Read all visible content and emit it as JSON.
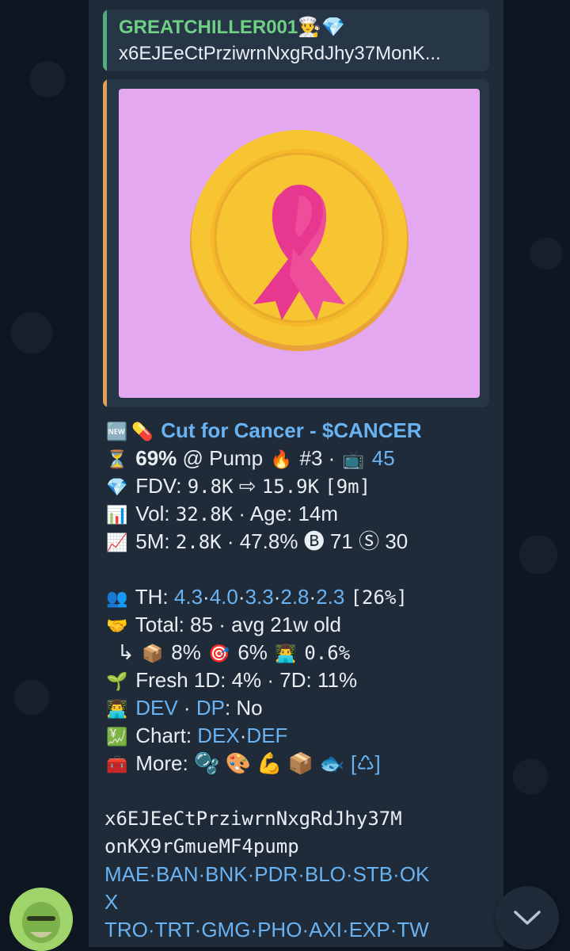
{
  "reply": {
    "author": "GREATCHILLER001👨‍🍳💎",
    "text": "x6EJEeCtPrziwrnNxgRdJhy37MonK..."
  },
  "token": {
    "badge_new": "🆕",
    "pill": "💊",
    "title": "Cut for Cancer - $CANCER"
  },
  "stats": {
    "progress_icon": "⏳",
    "progress_pct": "69%",
    "progress_text": "@ Pump",
    "fire": "🔥",
    "rank": "#3",
    "tv_icon": "📺",
    "tv_count": "45",
    "fdv_icon": "💎",
    "fdv_label": "FDV:",
    "fdv_from": "9.8K",
    "arrow": "⇨",
    "fdv_to": "15.9K",
    "fdv_time": "[9m]",
    "vol_icon": "📊",
    "vol_label": "Vol:",
    "vol_value": "32.8K",
    "age_label": "· Age: 14m",
    "m5_icon": "📈",
    "m5_label": "5M:",
    "m5_value": "2.8K",
    "m5_pct": "· 47.8%",
    "buy_icon": "🅑",
    "buys": "71",
    "sell_icon": "Ⓢ",
    "sells": "30"
  },
  "holders": {
    "th_icon": "👥",
    "th_label": "TH:",
    "th_values": [
      "4.3",
      "4.0",
      "3.3",
      "2.8",
      "2.3"
    ],
    "th_pct": "[26%]",
    "total_icon": "🤝",
    "total_text": "Total: 85 · avg 21w old",
    "sub_arrow": "↳",
    "box_icon": "📦",
    "box_pct": "8%",
    "target_icon": "🎯",
    "target_pct": "6%",
    "dev_icon": "👨‍💻",
    "dev_pct": "0.6%",
    "fresh_icon": "🌱",
    "fresh_text": "Fresh 1D: 4% · 7D: 11%",
    "dev_line_icon": "👨‍💻",
    "dev_link": "DEV",
    "dp_link": "DP",
    "dp_text": ": No",
    "chart_icon": "💹",
    "chart_label": "Chart:",
    "chart_links": [
      "DEX",
      "DEF"
    ],
    "more_icon": "🧰",
    "more_label": "More:",
    "more_icons": "🫧 🎨 💪 📦 🐟",
    "more_recycle": "[♺]"
  },
  "contract": {
    "address_line1": "x6EJEeCtPrziwrnNxgRdJhy37M",
    "address_line2": "onKX9rGmueMF4pump",
    "links_row1": [
      "MAE",
      "BAN",
      "BNK",
      "PDR",
      "BLO",
      "STB",
      "OK"
    ],
    "links_row1_wrap": "X",
    "links_row2": [
      "TRO",
      "TRT",
      "GMG",
      "PHO",
      "AXI",
      "EXP",
      "TW"
    ]
  },
  "colors": {
    "background": "#0e1621",
    "bubble": "#1f2b38",
    "link": "#6ab3f3",
    "reply_name": "#6fcf85",
    "coin_gold": "#f7c531",
    "ribbon_pink": "#e8378f",
    "art_bg": "#e3a8ef"
  }
}
